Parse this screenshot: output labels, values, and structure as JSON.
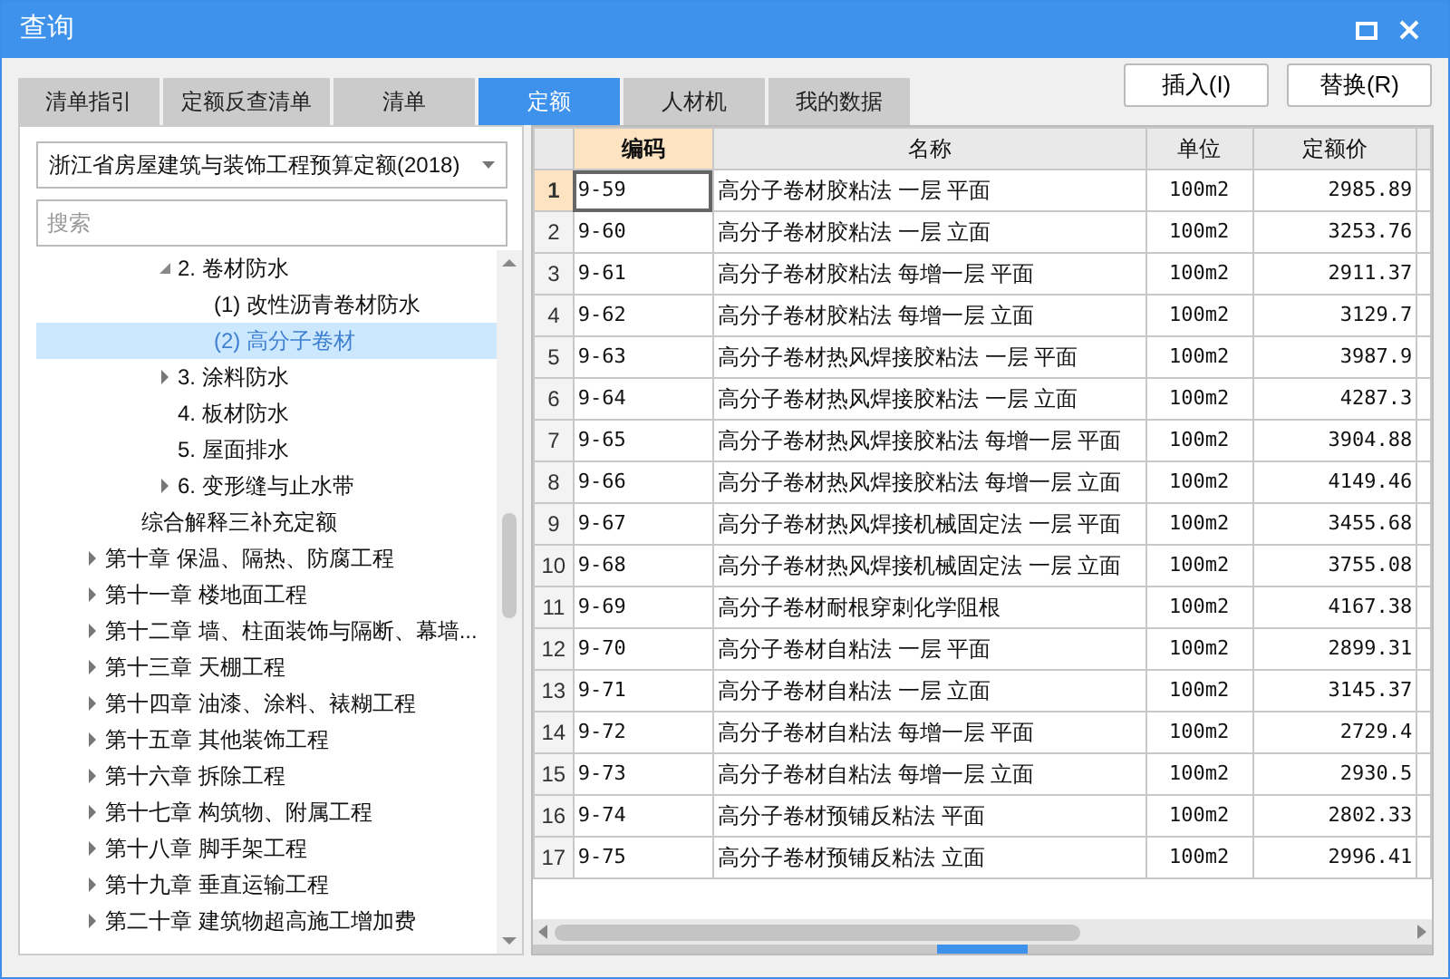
{
  "window": {
    "title": "查询"
  },
  "tabs": [
    {
      "label": "清单指引",
      "selected": false
    },
    {
      "label": "定额反查清单",
      "selected": false
    },
    {
      "label": "清单",
      "selected": false
    },
    {
      "label": "定额",
      "selected": true
    },
    {
      "label": "人材机",
      "selected": false
    },
    {
      "label": "我的数据",
      "selected": false
    }
  ],
  "buttons": [
    "插入(I)",
    "替换(R)"
  ],
  "quota_select": {
    "value": "浙江省房屋建筑与装饰工程预算定额(2018)"
  },
  "search": {
    "placeholder": "搜索"
  },
  "tree": {
    "items": [
      {
        "children": [
          {
            "children": [
              {
                "label": "2. 卷材防水",
                "expanded": true,
                "selected": false,
                "children": [
                  {
                    "label": "(1) 改性沥青卷材防水",
                    "selected": false
                  },
                  {
                    "label": "(2) 高分子卷材",
                    "selected": true
                  }
                ]
              },
              {
                "label": "3. 涂料防水",
                "expanded": false,
                "selected": false
              },
              {
                "label": "4. 板材防水",
                "selected": false
              },
              {
                "label": "5. 屋面排水",
                "selected": false
              },
              {
                "label": "6. 变形缝与止水带",
                "expanded": false,
                "selected": false
              }
            ]
          },
          {
            "label": "综合解释三补充定额",
            "selected": false
          }
        ]
      },
      {
        "label": "第十章 保温、隔热、防腐工程",
        "expanded": false,
        "selected": false
      },
      {
        "label": "第十一章 楼地面工程",
        "expanded": false,
        "selected": false
      },
      {
        "label": "第十二章 墙、柱面装饰与隔断、幕墙...",
        "expanded": false,
        "selected": false
      },
      {
        "label": "第十三章 天棚工程",
        "expanded": false,
        "selected": false
      },
      {
        "label": "第十四章 油漆、涂料、裱糊工程",
        "expanded": false,
        "selected": false
      },
      {
        "label": "第十五章 其他装饰工程",
        "expanded": false,
        "selected": false
      },
      {
        "label": "第十六章 拆除工程",
        "expanded": false,
        "selected": false
      },
      {
        "label": "第十七章 构筑物、附属工程",
        "expanded": false,
        "selected": false
      },
      {
        "label": "第十八章 脚手架工程",
        "expanded": false,
        "selected": false
      },
      {
        "label": "第十九章 垂直运输工程",
        "expanded": false,
        "selected": false
      },
      {
        "label": "第二十章 建筑物超高施工增加费",
        "expanded": false,
        "selected": false
      }
    ]
  },
  "table": {
    "columns": [
      "编码",
      "名称",
      "单位",
      "定额价"
    ],
    "rows": [
      {
        "index": "1",
        "cells": [
          "9-59",
          "高分子卷材胶粘法 一层 平面",
          "100m2",
          "2985.89"
        ],
        "selected": true
      },
      {
        "index": "2",
        "cells": [
          "9-60",
          "高分子卷材胶粘法 一层 立面",
          "100m2",
          "3253.76"
        ],
        "selected": false
      },
      {
        "index": "3",
        "cells": [
          "9-61",
          "高分子卷材胶粘法 每增一层 平面",
          "100m2",
          "2911.37"
        ],
        "selected": false
      },
      {
        "index": "4",
        "cells": [
          "9-62",
          "高分子卷材胶粘法 每增一层 立面",
          "100m2",
          "3129.7"
        ],
        "selected": false
      },
      {
        "index": "5",
        "cells": [
          "9-63",
          "高分子卷材热风焊接胶粘法 一层 平面",
          "100m2",
          "3987.9"
        ],
        "selected": false
      },
      {
        "index": "6",
        "cells": [
          "9-64",
          "高分子卷材热风焊接胶粘法 一层 立面",
          "100m2",
          "4287.3"
        ],
        "selected": false
      },
      {
        "index": "7",
        "cells": [
          "9-65",
          "高分子卷材热风焊接胶粘法 每增一层 平面",
          "100m2",
          "3904.88"
        ],
        "selected": false
      },
      {
        "index": "8",
        "cells": [
          "9-66",
          "高分子卷材热风焊接胶粘法 每增一层 立面",
          "100m2",
          "4149.46"
        ],
        "selected": false
      },
      {
        "index": "9",
        "cells": [
          "9-67",
          "高分子卷材热风焊接机械固定法 一层 平面",
          "100m2",
          "3455.68"
        ],
        "selected": false
      },
      {
        "index": "10",
        "cells": [
          "9-68",
          "高分子卷材热风焊接机械固定法 一层 立面",
          "100m2",
          "3755.08"
        ],
        "selected": false
      },
      {
        "index": "11",
        "cells": [
          "9-69",
          "高分子卷材耐根穿刺化学阻根",
          "100m2",
          "4167.38"
        ],
        "selected": false
      },
      {
        "index": "12",
        "cells": [
          "9-70",
          "高分子卷材自粘法 一层 平面",
          "100m2",
          "2899.31"
        ],
        "selected": false
      },
      {
        "index": "13",
        "cells": [
          "9-71",
          "高分子卷材自粘法 一层 立面",
          "100m2",
          "3145.37"
        ],
        "selected": false
      },
      {
        "index": "14",
        "cells": [
          "9-72",
          "高分子卷材自粘法 每增一层 平面",
          "100m2",
          "2729.4"
        ],
        "selected": false
      },
      {
        "index": "15",
        "cells": [
          "9-73",
          "高分子卷材自粘法 每增一层 立面",
          "100m2",
          "2930.5"
        ],
        "selected": false
      },
      {
        "index": "16",
        "cells": [
          "9-74",
          "高分子卷材预铺反粘法 平面",
          "100m2",
          "2802.33"
        ],
        "selected": false
      },
      {
        "index": "17",
        "cells": [
          "9-75",
          "高分子卷材预铺反粘法 立面",
          "100m2",
          "2996.41"
        ],
        "selected": false
      }
    ]
  }
}
